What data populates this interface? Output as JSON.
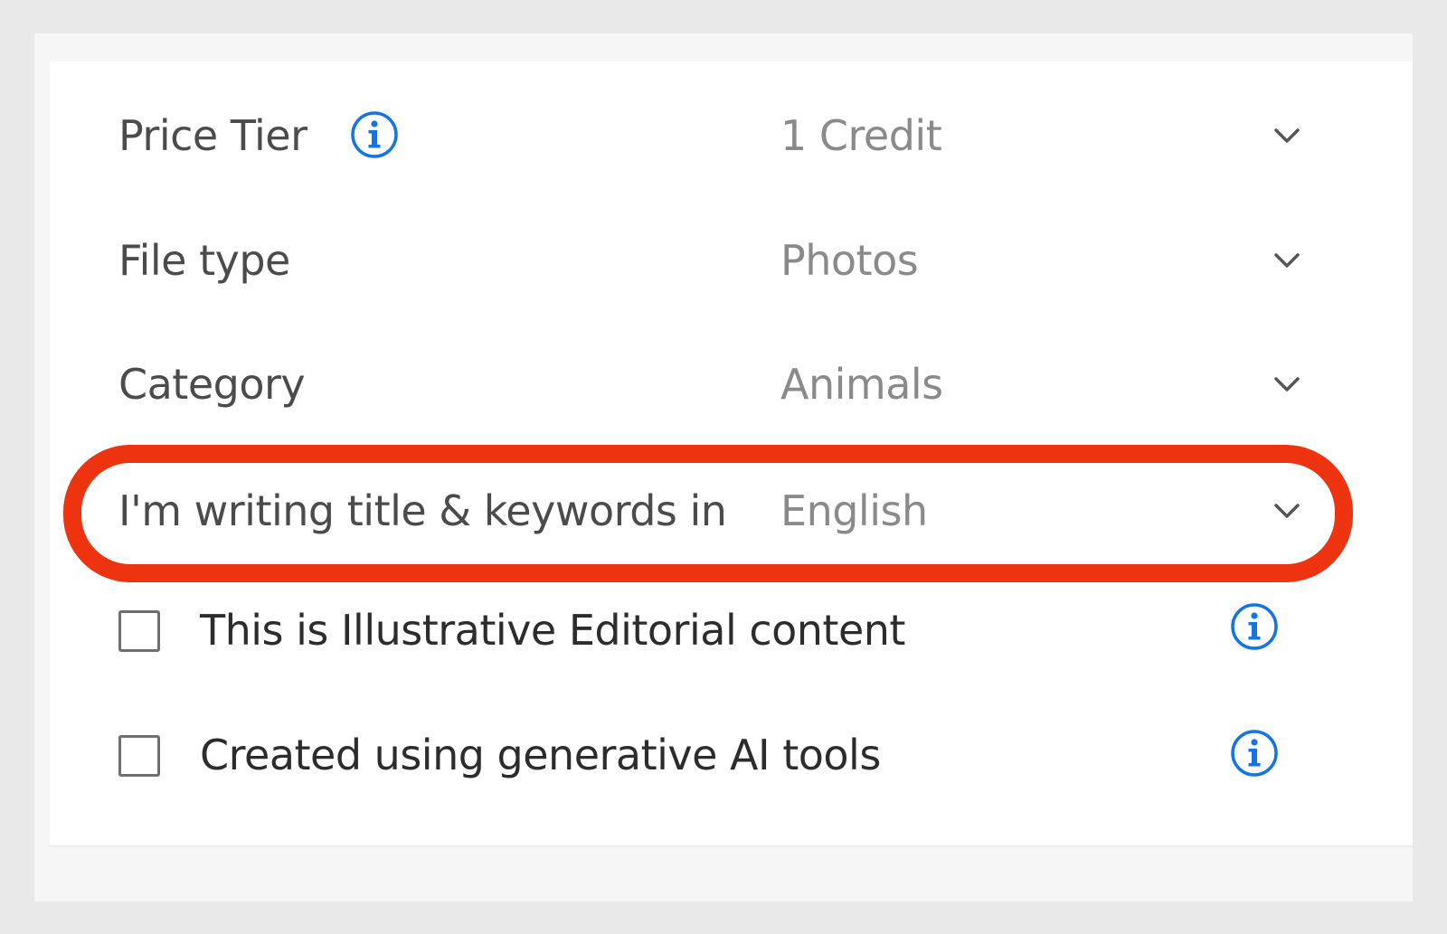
{
  "form": {
    "price_tier": {
      "label": "Price Tier",
      "value": "1 Credit",
      "icon": "info-icon"
    },
    "file_type": {
      "label": "File type",
      "value": "Photos"
    },
    "category": {
      "label": "Category",
      "value": "Animals"
    },
    "language": {
      "label": "I'm writing title & keywords in",
      "value": "English"
    },
    "checkboxes": [
      {
        "label": "This is Illustrative Editorial content",
        "checked": false,
        "icon": "info-icon"
      },
      {
        "label": "Created using generative AI tools",
        "checked": false,
        "icon": "info-icon"
      }
    ]
  },
  "colors": {
    "accent": "#1473e6",
    "highlight": "#ee3311",
    "label": "#4b4b4b",
    "value": "#8a8a8a"
  }
}
